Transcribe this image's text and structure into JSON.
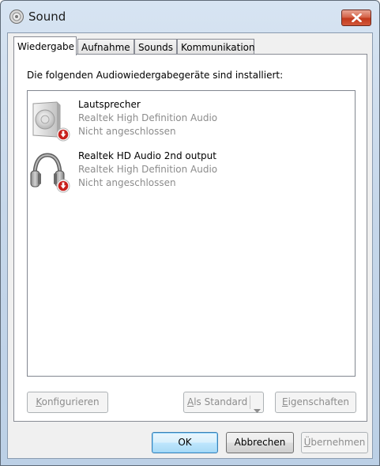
{
  "window": {
    "title": "Sound",
    "icon": "speaker-app-icon",
    "close_icon": "close-icon"
  },
  "tabs": [
    {
      "label": "Wiedergabe",
      "active": true
    },
    {
      "label": "Aufnahme",
      "active": false
    },
    {
      "label": "Sounds",
      "active": false
    },
    {
      "label": "Kommunikation",
      "active": false
    }
  ],
  "panel": {
    "instruction": "Die folgenden Audiowiedergabegeräte sind installiert:"
  },
  "devices": [
    {
      "name": "Lautsprecher",
      "driver": "Realtek High Definition Audio",
      "status": "Nicht angeschlossen",
      "icon": "speaker-icon",
      "status_icon": "disconnected-icon"
    },
    {
      "name": "Realtek HD Audio 2nd output",
      "driver": "Realtek High Definition Audio",
      "status": "Nicht angeschlossen",
      "icon": "headphones-icon",
      "status_icon": "disconnected-icon"
    }
  ],
  "panel_buttons": {
    "configure": {
      "mnemonic": "K",
      "rest": "onfigurieren",
      "enabled": false
    },
    "set_default": {
      "mnemonic": "A",
      "rest": "ls Standard",
      "enabled": false
    },
    "properties": {
      "mnemonic": "E",
      "rest": "igenschaften",
      "enabled": false
    }
  },
  "dialog_buttons": {
    "ok": {
      "label": "OK",
      "enabled": true
    },
    "cancel": {
      "label": "Abbrechen",
      "enabled": true
    },
    "apply": {
      "mnemonic": "Ü",
      "rest": "bernehmen",
      "enabled": false
    }
  },
  "colors": {
    "disabled_text": "#8d8d8d",
    "secondary_text": "#8c8c8c",
    "status_red": "#c8201c"
  }
}
